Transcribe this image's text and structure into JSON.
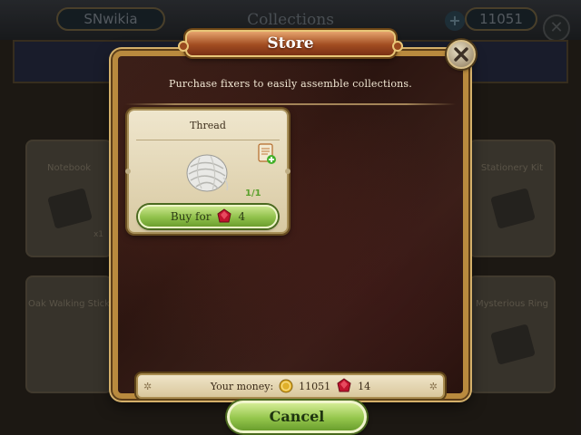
{
  "background": {
    "username": "SNwikia",
    "screen_title": "Collections",
    "money_display": "11051",
    "cards": [
      {
        "label": "Notebook",
        "sub": "x1"
      },
      {
        "label": "Stationery Kit",
        "sub": ""
      },
      {
        "label": "Oak Walking Stick",
        "sub": ""
      },
      {
        "label": "Mysterious Ring",
        "sub": ""
      }
    ]
  },
  "store": {
    "title": "Store",
    "subtitle": "Purchase fixers to easily assemble collections.",
    "items": [
      {
        "name": "Thread",
        "count": "1/1",
        "buy_label": "Buy for",
        "price": "4",
        "currency_icon": "ruby-icon",
        "image_icon": "thread-ball-icon"
      }
    ],
    "money": {
      "label": "Your money:",
      "coins": "11051",
      "rubies": "14"
    },
    "cancel_label": "Cancel"
  },
  "colors": {
    "accent_green": "#8fc04a",
    "frame_gold": "#b98a3e",
    "banner_orange": "#a24d22",
    "ruby_red": "#c0142e",
    "coin_gold": "#e0b02a"
  }
}
